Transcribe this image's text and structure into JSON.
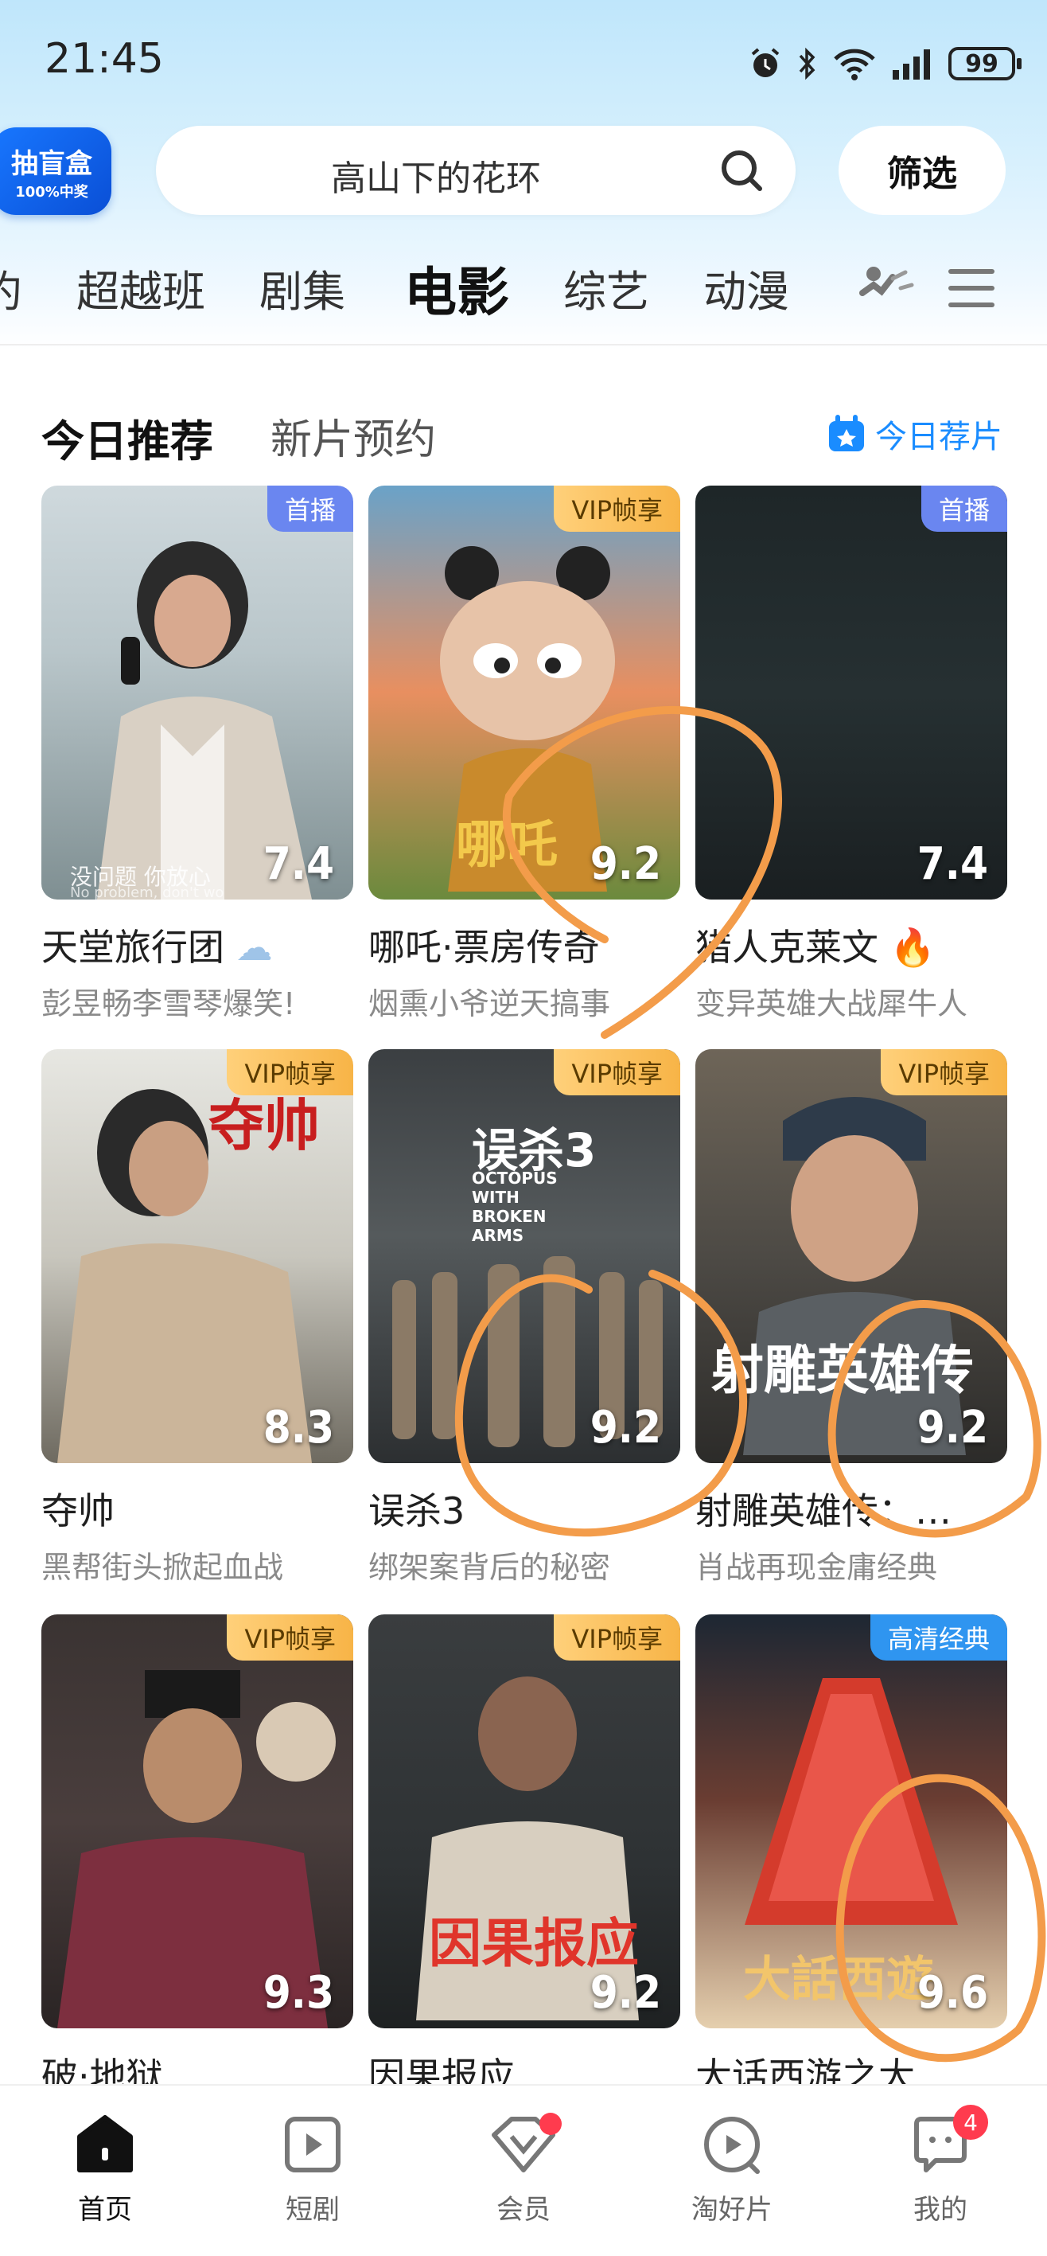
{
  "status_bar": {
    "time": "21:45",
    "battery": "99"
  },
  "header": {
    "blind_box": {
      "line1": "抽盲盒",
      "line2": "100%中奖"
    },
    "search": {
      "query": "高山下的花环"
    },
    "filter_label": "筛选"
  },
  "channel_tabs": [
    {
      "label": "约"
    },
    {
      "label": "超越班"
    },
    {
      "label": "剧集"
    },
    {
      "label": "电影",
      "active": true
    },
    {
      "label": "综艺"
    },
    {
      "label": "动漫"
    }
  ],
  "section": {
    "tabs": [
      "今日推荐",
      "新片预约"
    ],
    "right_link": "今日荐片"
  },
  "movies": [
    {
      "title": "天堂旅行团",
      "subtitle": "彭昱畅李雪琴爆笑!",
      "badge": "首播",
      "badge_type": "first",
      "score": "7.4",
      "caption": "没问题 你放心",
      "caption_en": "No problem, don't wo"
    },
    {
      "title": "哪吒·票房传奇",
      "subtitle": "烟熏小爷逆天搞事",
      "badge": "VIP帧享",
      "badge_type": "vip",
      "score": "9.2"
    },
    {
      "title": "猎人克莱文",
      "subtitle": "变异英雄大战犀牛人",
      "badge": "首播",
      "badge_type": "first",
      "score": "7.4"
    },
    {
      "title": "夺帅",
      "subtitle": "黑帮街头掀起血战",
      "badge": "VIP帧享",
      "badge_type": "vip",
      "score": "8.3"
    },
    {
      "title": "误杀3",
      "subtitle": "绑架案背后的秘密",
      "badge": "VIP帧享",
      "badge_type": "vip",
      "score": "9.2",
      "poster_text": "误杀3",
      "poster_en": "OCTOPUS WITH BROKEN ARMS"
    },
    {
      "title": "射雕英雄传：…",
      "subtitle": "肖战再现金庸经典",
      "badge": "VIP帧享",
      "badge_type": "vip",
      "score": "9.2",
      "poster_text": "射雕英雄传"
    },
    {
      "title": "破·地狱",
      "subtitle": "",
      "badge": "VIP帧享",
      "badge_type": "vip",
      "score": "9.3"
    },
    {
      "title": "因果报应",
      "subtitle": "",
      "badge": "VIP帧享",
      "badge_type": "vip",
      "score": "9.2",
      "poster_text": "因果报应"
    },
    {
      "title": "大话西游之大…",
      "subtitle": "",
      "badge": "高清经典",
      "badge_type": "classic",
      "score": "9.6",
      "poster_text": "大話西遊"
    }
  ],
  "bottom_nav": [
    {
      "label": "首页",
      "icon": "home-icon",
      "active": true
    },
    {
      "label": "短剧",
      "icon": "play-square-icon"
    },
    {
      "label": "会员",
      "icon": "vip-diamond-icon",
      "dot": true
    },
    {
      "label": "淘好片",
      "icon": "play-circle-icon"
    },
    {
      "label": "我的",
      "icon": "profile-chat-icon",
      "count": "4"
    }
  ],
  "colors": {
    "accent": "#1a8cff",
    "vip_badge": "#f7b447",
    "first_badge": "#6a86f0",
    "classic_badge": "#2f95f0",
    "annotation": "#f39c4a"
  }
}
